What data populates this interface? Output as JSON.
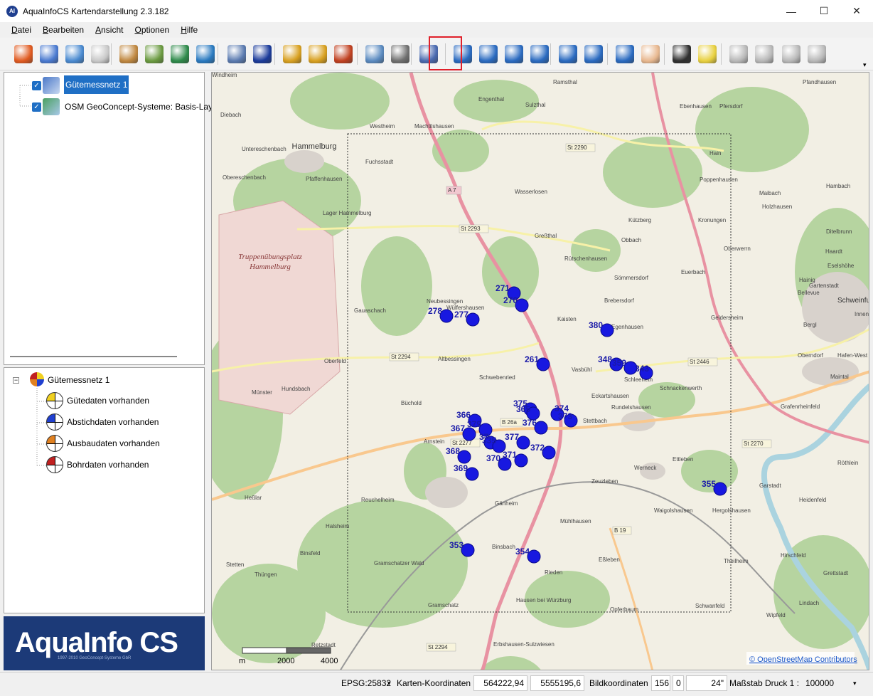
{
  "window": {
    "title": "AquaInfoCS Kartendarstellung 2.3.182",
    "icon_text": "AI",
    "minimize": "—",
    "maximize": "☐",
    "close": "✕"
  },
  "menu": [
    {
      "label": "Datei",
      "u": "D",
      "rest": "atei"
    },
    {
      "label": "Bearbeiten",
      "u": "B",
      "rest": "earbeiten"
    },
    {
      "label": "Ansicht",
      "u": "A",
      "rest": "nsicht"
    },
    {
      "label": "Optionen",
      "u": "O",
      "rest": "ptionen"
    },
    {
      "label": "Hilfe",
      "u": "H",
      "rest": "ilfe"
    }
  ],
  "toolbar": {
    "overflow": "▾",
    "tools": [
      {
        "name": "network-properties-tool",
        "color": "#e05a20"
      },
      {
        "name": "network-add-tool",
        "color": "#4a7ad0"
      },
      {
        "name": "network-edit-tool",
        "color": "#4a8ad0"
      },
      {
        "name": "layer-disabled-tool",
        "color": "#c8c8c8"
      },
      {
        "name": "layer-color-tool",
        "color": "#c08840"
      },
      {
        "name": "layer-green-tool",
        "color": "#6a9a40"
      },
      {
        "name": "layer-globe-tool",
        "color": "#2e8a4a"
      },
      {
        "name": "globe-tool",
        "color": "#2a7ac0"
      },
      {
        "name": "document-tool",
        "color": "#5a7ab0"
      },
      {
        "name": "info-tool",
        "color": "#1a3a9a"
      },
      {
        "name": "export-tool",
        "color": "#d8a020"
      },
      {
        "name": "import-tool",
        "color": "#d8a020"
      },
      {
        "name": "transfer-tool",
        "color": "#c04020"
      },
      {
        "name": "print-preview-tool",
        "color": "#5a8ac0"
      },
      {
        "name": "print-tool",
        "color": "#707070"
      },
      {
        "name": "add-point-tool",
        "color": "#4a6ab0"
      },
      {
        "name": "zoom-extent-tool",
        "color": "#2a6ac0"
      },
      {
        "name": "zoom-window-tool",
        "color": "#2a6ac0"
      },
      {
        "name": "zoom-in-tool",
        "color": "#2a6ac0"
      },
      {
        "name": "zoom-out-tool",
        "color": "#2a6ac0"
      },
      {
        "name": "undo-view-tool",
        "color": "#2a6ac0"
      },
      {
        "name": "redo-view-tool",
        "color": "#2a6ac0"
      },
      {
        "name": "zoom-selection-tool",
        "color": "#2a6ac0"
      },
      {
        "name": "pan-tool",
        "color": "#e8b890"
      },
      {
        "name": "select-tool",
        "color": "#303030"
      },
      {
        "name": "crosshair-tool",
        "color": "#e8d040"
      },
      {
        "name": "well-disabled-tool",
        "color": "#b8b8b8"
      },
      {
        "name": "table-disabled-tool",
        "color": "#b8b8b8"
      },
      {
        "name": "info-disabled-tool",
        "color": "#b8b8b8"
      },
      {
        "name": "measure-disabled-tool",
        "color": "#b8b8b8"
      }
    ]
  },
  "layers": {
    "items": [
      {
        "label": "Gütemessnetz 1",
        "selected": true
      },
      {
        "label": "OSM GeoConcept-Systeme: Basis-Layer:",
        "selected": false
      }
    ]
  },
  "legend": {
    "title": "Gütemessnetz 1",
    "collapse": "−",
    "items": [
      {
        "label": "Gütedaten vorhanden",
        "color": "#f0d020"
      },
      {
        "label": "Abstichdaten vorhanden",
        "color": "#2040d0"
      },
      {
        "label": "Ausbaudaten vorhanden",
        "color": "#e08020"
      },
      {
        "label": "Bohrdaten vorhanden",
        "color": "#c02020"
      }
    ]
  },
  "logo": {
    "text": "AquaInfo CS",
    "sub": "1997-2010 GeoConcept-Systeme GbR"
  },
  "map": {
    "scalebar": {
      "unit": "m",
      "mid": "2000",
      "max": "4000"
    },
    "attribution": "© OpenStreetMap Contributors",
    "area_label_line1": "Truppenübungsplatz",
    "area_label_line2": "Hammelburg",
    "town_hammelburg": "Hammelburg",
    "town_schweinfurt": "Schweinfurt",
    "places": [
      "Windheim",
      "Diebach",
      "Westheim",
      "Machtilshausen",
      "Sulzthal",
      "Ramsthal",
      "Pfandhausen",
      "Ebenhausen",
      "Pfersdorf",
      "Engenthal",
      "Untereschenbach",
      "Obereschenbach",
      "Fuchsstadt",
      "Wasserlosen",
      "Hain",
      "Poppenhausen",
      "Maibach",
      "Hambach",
      "Holzhausen",
      "Pfaffenhausen",
      "Lager Hammelburg",
      "Greßthal",
      "Kützberg",
      "Kronungen",
      "Ditelbrunn",
      "Obbach",
      "Oberwerrn",
      "Haardt",
      "Rütschenhausen",
      "Sömmersdorf",
      "Euerbach",
      "Eselshöhe",
      "Hainig",
      "Gartenstadt",
      "Bellevue",
      "Neubessingen",
      "Wülfershausen",
      "Gauaschach",
      "Brebersdorf",
      "Geldersheim",
      "Innenstadt",
      "Kaisten",
      "Egenhausen",
      "Bergl",
      "Oberndorf",
      "Hafen-West",
      "Maintal",
      "Oberfeld",
      "Altbessingen",
      "Vasbühl",
      "Schleerieth",
      "Schnackenwerth",
      "Schwebenried",
      "Münster",
      "Hundsbach",
      "Büchold",
      "Eckartshausen",
      "Rundelshausen",
      "Stettbach",
      "Grafenrheinfeld",
      "Ettleben",
      "Werneck",
      "Röthlein",
      "Arnstein",
      "Zeuzleben",
      "Garstadt",
      "Heßlar",
      "Reuchelheim",
      "Gänheim",
      "Waigolshausen",
      "Hergolshausen",
      "Heidenfeld",
      "Halsheim",
      "Mühlhausen",
      "Binsfeld",
      "Binsbach",
      "Eßleben",
      "Hirschfeld",
      "Stetten",
      "Thüngen",
      "Rieden",
      "Theilheim",
      "Grettstadt",
      "Hausen bei Würzburg",
      "Opferbaum",
      "Schwanfeld",
      "Wipfeld",
      "Gramschatz",
      "Lindach",
      "Retzstadt",
      "Erbshausen-Sulzwiesen",
      "Gramschatzer Wald"
    ],
    "roads": [
      "St 2290",
      "A 7",
      "St 2293",
      "St 2294",
      "B 26a",
      "St 2446",
      "St 2270",
      "B 19",
      "St 2294",
      "St 2277"
    ],
    "points": [
      {
        "id": "271"
      },
      {
        "id": "270"
      },
      {
        "id": "278"
      },
      {
        "id": "277"
      },
      {
        "id": "380"
      },
      {
        "id": "261"
      },
      {
        "id": "348"
      },
      {
        "id": "359"
      },
      {
        "id": "343"
      },
      {
        "id": "375"
      },
      {
        "id": "365"
      },
      {
        "id": "374"
      },
      {
        "id": "373"
      },
      {
        "id": "376"
      },
      {
        "id": "366"
      },
      {
        "id": "379"
      },
      {
        "id": "367"
      },
      {
        "id": "37"
      },
      {
        "id": "335"
      },
      {
        "id": "377"
      },
      {
        "id": "372"
      },
      {
        "id": "368"
      },
      {
        "id": "370"
      },
      {
        "id": "371"
      },
      {
        "id": "369"
      },
      {
        "id": "355"
      },
      {
        "id": "353"
      },
      {
        "id": "354"
      }
    ]
  },
  "status": {
    "epsg": "EPSG:25832",
    "epsg_arrow": "▾",
    "map_coords_label": "Karten-Koordinaten",
    "x": "564222,94",
    "y": "5555195,6",
    "image_coords_label": "Bildkoordinaten",
    "px": "156",
    "py": "0",
    "size": "24\"",
    "scale_label": "Maßstab Druck 1 :",
    "scale_value": "100000",
    "scale_arrow": "▾"
  }
}
